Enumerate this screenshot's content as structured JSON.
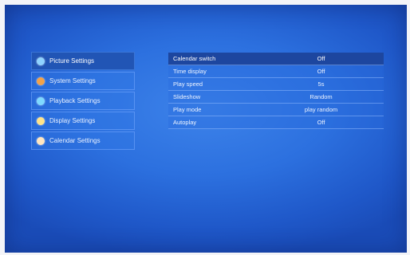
{
  "menu": {
    "items": [
      {
        "label": "Picture Settings",
        "color": "#8fd3ff",
        "selected": true
      },
      {
        "label": "System Settings",
        "color": "#f2a24a",
        "selected": false
      },
      {
        "label": "Playback Settings",
        "color": "#7fd9ff",
        "selected": false
      },
      {
        "label": "Display Settings",
        "color": "#ffe38a",
        "selected": false
      },
      {
        "label": "Calendar Settings",
        "color": "#ffe6c0",
        "selected": false
      }
    ]
  },
  "settings": {
    "rows": [
      {
        "label": "Calendar switch",
        "value": "Off",
        "selected": true
      },
      {
        "label": "Time display",
        "value": "Off",
        "selected": false
      },
      {
        "label": "Play speed",
        "value": "5s",
        "selected": false
      },
      {
        "label": "Slideshow",
        "value": "Random",
        "selected": false
      },
      {
        "label": "Play mode",
        "value": "play random",
        "selected": false
      },
      {
        "label": "Autoplay",
        "value": "Off",
        "selected": false
      }
    ]
  }
}
